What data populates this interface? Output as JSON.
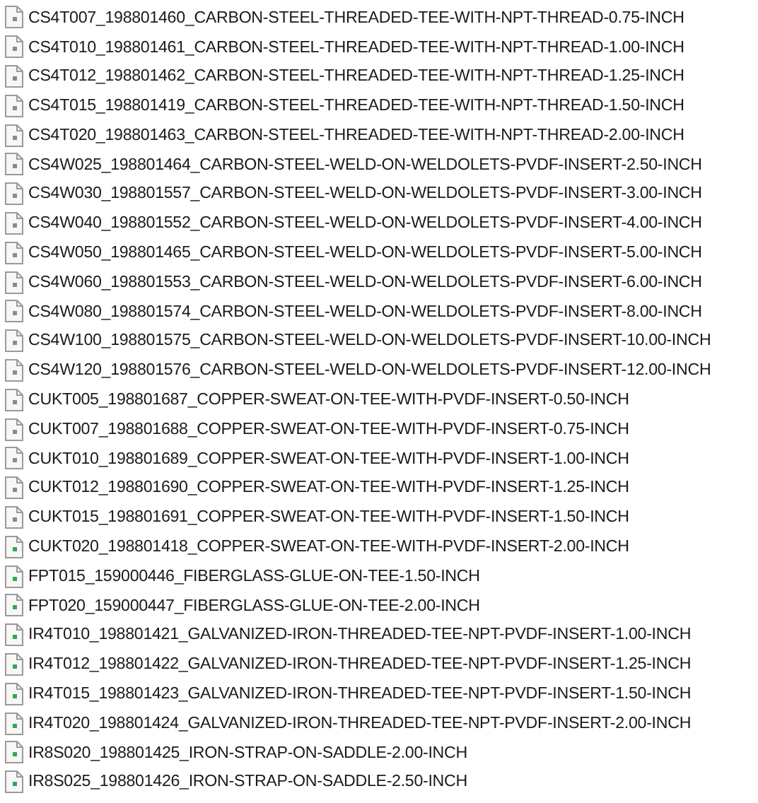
{
  "files": [
    {
      "name": "CS4T007_198801460_CARBON-STEEL-THREADED-TEE-WITH-NPT-THREAD-0.75-INCH",
      "color": "#8a8a8a"
    },
    {
      "name": "CS4T010_198801461_CARBON-STEEL-THREADED-TEE-WITH-NPT-THREAD-1.00-INCH",
      "color": "#8a8a8a"
    },
    {
      "name": "CS4T012_198801462_CARBON-STEEL-THREADED-TEE-WITH-NPT-THREAD-1.25-INCH",
      "color": "#8a8a8a"
    },
    {
      "name": "CS4T015_198801419_CARBON-STEEL-THREADED-TEE-WITH-NPT-THREAD-1.50-INCH",
      "color": "#8a8a8a"
    },
    {
      "name": "CS4T020_198801463_CARBON-STEEL-THREADED-TEE-WITH-NPT-THREAD-2.00-INCH",
      "color": "#8a8a8a"
    },
    {
      "name": "CS4W025_198801464_CARBON-STEEL-WELD-ON-WELDOLETS-PVDF-INSERT-2.50-INCH",
      "color": "#8a8a8a"
    },
    {
      "name": "CS4W030_198801557_CARBON-STEEL-WELD-ON-WELDOLETS-PVDF-INSERT-3.00-INCH",
      "color": "#8a8a8a"
    },
    {
      "name": "CS4W040_198801552_CARBON-STEEL-WELD-ON-WELDOLETS-PVDF-INSERT-4.00-INCH",
      "color": "#8a8a8a"
    },
    {
      "name": "CS4W050_198801465_CARBON-STEEL-WELD-ON-WELDOLETS-PVDF-INSERT-5.00-INCH",
      "color": "#8a8a8a"
    },
    {
      "name": "CS4W060_198801553_CARBON-STEEL-WELD-ON-WELDOLETS-PVDF-INSERT-6.00-INCH",
      "color": "#8a8a8a"
    },
    {
      "name": "CS4W080_198801574_CARBON-STEEL-WELD-ON-WELDOLETS-PVDF-INSERT-8.00-INCH",
      "color": "#8a8a8a"
    },
    {
      "name": "CS4W100_198801575_CARBON-STEEL-WELD-ON-WELDOLETS-PVDF-INSERT-10.00-INCH",
      "color": "#8a8a8a"
    },
    {
      "name": "CS4W120_198801576_CARBON-STEEL-WELD-ON-WELDOLETS-PVDF-INSERT-12.00-INCH",
      "color": "#8a8a8a"
    },
    {
      "name": "CUKT005_198801687_COPPER-SWEAT-ON-TEE-WITH-PVDF-INSERT-0.50-INCH",
      "color": "#8a8a8a"
    },
    {
      "name": "CUKT007_198801688_COPPER-SWEAT-ON-TEE-WITH-PVDF-INSERT-0.75-INCH",
      "color": "#8a8a8a"
    },
    {
      "name": "CUKT010_198801689_COPPER-SWEAT-ON-TEE-WITH-PVDF-INSERT-1.00-INCH",
      "color": "#8a8a8a"
    },
    {
      "name": "CUKT012_198801690_COPPER-SWEAT-ON-TEE-WITH-PVDF-INSERT-1.25-INCH",
      "color": "#8a8a8a"
    },
    {
      "name": "CUKT015_198801691_COPPER-SWEAT-ON-TEE-WITH-PVDF-INSERT-1.50-INCH",
      "color": "#8a8a8a"
    },
    {
      "name": "CUKT020_198801418_COPPER-SWEAT-ON-TEE-WITH-PVDF-INSERT-2.00-INCH",
      "color": "#2fa84f"
    },
    {
      "name": "FPT015_159000446_FIBERGLASS-GLUE-ON-TEE-1.50-INCH",
      "color": "#2fa84f"
    },
    {
      "name": "FPT020_159000447_FIBERGLASS-GLUE-ON-TEE-2.00-INCH",
      "color": "#2fa84f"
    },
    {
      "name": "IR4T010_198801421_GALVANIZED-IRON-THREADED-TEE-NPT-PVDF-INSERT-1.00-INCH",
      "color": "#2fa84f"
    },
    {
      "name": "IR4T012_198801422_GALVANIZED-IRON-THREADED-TEE-NPT-PVDF-INSERT-1.25-INCH",
      "color": "#2fa84f"
    },
    {
      "name": "IR4T015_198801423_GALVANIZED-IRON-THREADED-TEE-NPT-PVDF-INSERT-1.50-INCH",
      "color": "#2fa84f"
    },
    {
      "name": "IR4T020_198801424_GALVANIZED-IRON-THREADED-TEE-NPT-PVDF-INSERT-2.00-INCH",
      "color": "#2fa84f"
    },
    {
      "name": "IR8S020_198801425_IRON-STRAP-ON-SADDLE-2.00-INCH",
      "color": "#2fa84f"
    },
    {
      "name": "IR8S025_198801426_IRON-STRAP-ON-SADDLE-2.50-INCH",
      "color": "#2fa84f"
    }
  ]
}
